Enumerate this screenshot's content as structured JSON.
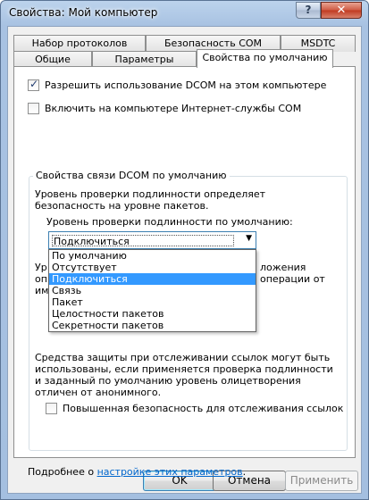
{
  "window": {
    "title": "Свойства: Мой компьютер",
    "help_glyph": "?",
    "close_glyph": "✕"
  },
  "tabs": {
    "row_top": [
      "Набор протоколов",
      "Безопасность COM",
      "MSDTC"
    ],
    "row_bottom": [
      "Общие",
      "Параметры",
      "Свойства по умолчанию"
    ],
    "active": "Свойства по умолчанию"
  },
  "options": {
    "enable_dcom": {
      "label": "Разрешить использование DCOM на этом компьютере",
      "checked": true
    },
    "enable_com_internet": {
      "label": "Включить на компьютере Интернет-службы COM",
      "checked": false
    }
  },
  "group": {
    "title": "Свойства связи DCOM по умолчанию",
    "auth_description": "Уровень проверки подлинности определяет безопасность на уровне пакетов.",
    "auth_label": "Уровень проверки подлинности по умолчанию:",
    "auth_selected": "Подключиться",
    "auth_options": [
      "По умолчанию",
      "Отсутствует",
      "Подключиться",
      "Связь",
      "Пакет",
      "Целостности пакетов",
      "Секретности пакетов"
    ],
    "behind_text_line1_start": "Ур",
    "behind_text_line1_end": "ложения",
    "behind_text_line2_start": "оп",
    "behind_text_line2_end": "операции от",
    "behind_text_line3_start": "им",
    "tracking_description": "Средства защиты при отслеживании ссылок могут быть использованы, если применяется проверка подлинности и заданный по умолчанию уровень олицетворения отличен от анонимного.",
    "secure_tracking": {
      "label": "Повышенная безопасность для отслеживания ссылок",
      "checked": false
    }
  },
  "footer": {
    "more_prefix": "Подробнее о ",
    "more_link": "настройке этих параметров",
    "more_suffix": "."
  },
  "buttons": {
    "ok": "OK",
    "cancel": "Отмена",
    "apply": "Применить"
  }
}
